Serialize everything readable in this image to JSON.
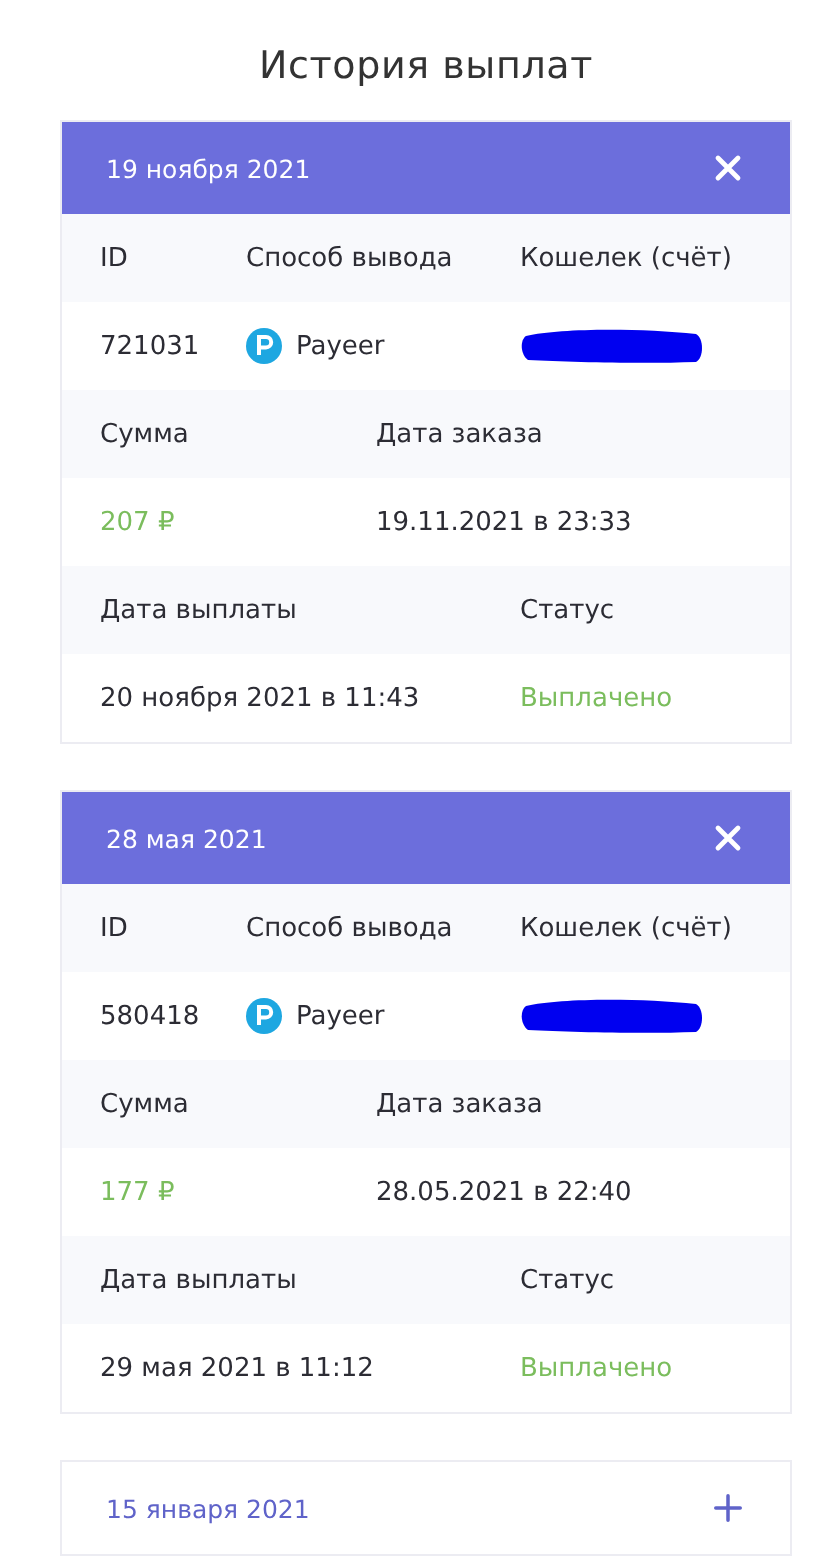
{
  "title": "История выплат",
  "payouts": [
    {
      "date": "19 ноября 2021",
      "expanded": true,
      "id_label": "ID",
      "method_label": "Способ вывода",
      "wallet_label": "Кошелек (счёт)",
      "id": "721031",
      "method": "Payeer",
      "sum_label": "Сумма",
      "order_date_label": "Дата заказа",
      "sum": "207 ₽",
      "order_date": "19.11.2021 в 23:33",
      "paid_date_label": "Дата выплаты",
      "status_label": "Статус",
      "paid_date": "20 ноября 2021 в 11:43",
      "status": "Выплачено"
    },
    {
      "date": "28 мая 2021",
      "expanded": true,
      "id_label": "ID",
      "method_label": "Способ вывода",
      "wallet_label": "Кошелек (счёт)",
      "id": "580418",
      "method": "Payeer",
      "sum_label": "Сумма",
      "order_date_label": "Дата заказа",
      "sum": "177 ₽",
      "order_date": "28.05.2021 в 22:40",
      "paid_date_label": "Дата выплаты",
      "status_label": "Статус",
      "paid_date": "29 мая 2021 в 11:12",
      "status": "Выплачено"
    },
    {
      "date": "15 января 2021",
      "expanded": false
    }
  ]
}
